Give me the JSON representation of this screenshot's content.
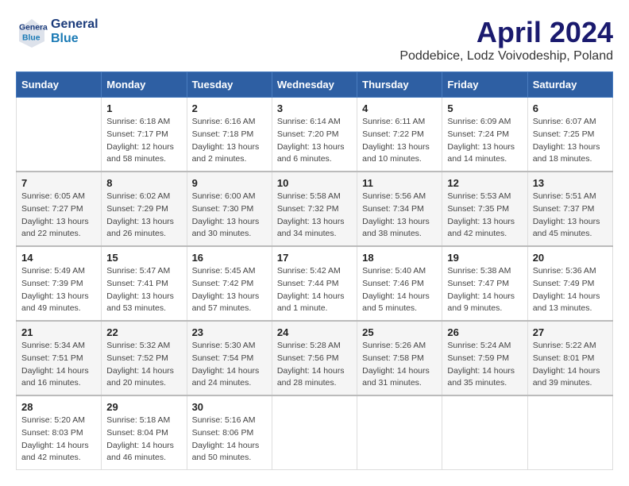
{
  "header": {
    "logo_line1": "General",
    "logo_line2": "Blue",
    "month": "April 2024",
    "location": "Poddebice, Lodz Voivodeship, Poland"
  },
  "weekdays": [
    "Sunday",
    "Monday",
    "Tuesday",
    "Wednesday",
    "Thursday",
    "Friday",
    "Saturday"
  ],
  "weeks": [
    [
      {
        "day": "",
        "info": ""
      },
      {
        "day": "1",
        "info": "Sunrise: 6:18 AM\nSunset: 7:17 PM\nDaylight: 12 hours\nand 58 minutes."
      },
      {
        "day": "2",
        "info": "Sunrise: 6:16 AM\nSunset: 7:18 PM\nDaylight: 13 hours\nand 2 minutes."
      },
      {
        "day": "3",
        "info": "Sunrise: 6:14 AM\nSunset: 7:20 PM\nDaylight: 13 hours\nand 6 minutes."
      },
      {
        "day": "4",
        "info": "Sunrise: 6:11 AM\nSunset: 7:22 PM\nDaylight: 13 hours\nand 10 minutes."
      },
      {
        "day": "5",
        "info": "Sunrise: 6:09 AM\nSunset: 7:24 PM\nDaylight: 13 hours\nand 14 minutes."
      },
      {
        "day": "6",
        "info": "Sunrise: 6:07 AM\nSunset: 7:25 PM\nDaylight: 13 hours\nand 18 minutes."
      }
    ],
    [
      {
        "day": "7",
        "info": "Sunrise: 6:05 AM\nSunset: 7:27 PM\nDaylight: 13 hours\nand 22 minutes."
      },
      {
        "day": "8",
        "info": "Sunrise: 6:02 AM\nSunset: 7:29 PM\nDaylight: 13 hours\nand 26 minutes."
      },
      {
        "day": "9",
        "info": "Sunrise: 6:00 AM\nSunset: 7:30 PM\nDaylight: 13 hours\nand 30 minutes."
      },
      {
        "day": "10",
        "info": "Sunrise: 5:58 AM\nSunset: 7:32 PM\nDaylight: 13 hours\nand 34 minutes."
      },
      {
        "day": "11",
        "info": "Sunrise: 5:56 AM\nSunset: 7:34 PM\nDaylight: 13 hours\nand 38 minutes."
      },
      {
        "day": "12",
        "info": "Sunrise: 5:53 AM\nSunset: 7:35 PM\nDaylight: 13 hours\nand 42 minutes."
      },
      {
        "day": "13",
        "info": "Sunrise: 5:51 AM\nSunset: 7:37 PM\nDaylight: 13 hours\nand 45 minutes."
      }
    ],
    [
      {
        "day": "14",
        "info": "Sunrise: 5:49 AM\nSunset: 7:39 PM\nDaylight: 13 hours\nand 49 minutes."
      },
      {
        "day": "15",
        "info": "Sunrise: 5:47 AM\nSunset: 7:41 PM\nDaylight: 13 hours\nand 53 minutes."
      },
      {
        "day": "16",
        "info": "Sunrise: 5:45 AM\nSunset: 7:42 PM\nDaylight: 13 hours\nand 57 minutes."
      },
      {
        "day": "17",
        "info": "Sunrise: 5:42 AM\nSunset: 7:44 PM\nDaylight: 14 hours\nand 1 minute."
      },
      {
        "day": "18",
        "info": "Sunrise: 5:40 AM\nSunset: 7:46 PM\nDaylight: 14 hours\nand 5 minutes."
      },
      {
        "day": "19",
        "info": "Sunrise: 5:38 AM\nSunset: 7:47 PM\nDaylight: 14 hours\nand 9 minutes."
      },
      {
        "day": "20",
        "info": "Sunrise: 5:36 AM\nSunset: 7:49 PM\nDaylight: 14 hours\nand 13 minutes."
      }
    ],
    [
      {
        "day": "21",
        "info": "Sunrise: 5:34 AM\nSunset: 7:51 PM\nDaylight: 14 hours\nand 16 minutes."
      },
      {
        "day": "22",
        "info": "Sunrise: 5:32 AM\nSunset: 7:52 PM\nDaylight: 14 hours\nand 20 minutes."
      },
      {
        "day": "23",
        "info": "Sunrise: 5:30 AM\nSunset: 7:54 PM\nDaylight: 14 hours\nand 24 minutes."
      },
      {
        "day": "24",
        "info": "Sunrise: 5:28 AM\nSunset: 7:56 PM\nDaylight: 14 hours\nand 28 minutes."
      },
      {
        "day": "25",
        "info": "Sunrise: 5:26 AM\nSunset: 7:58 PM\nDaylight: 14 hours\nand 31 minutes."
      },
      {
        "day": "26",
        "info": "Sunrise: 5:24 AM\nSunset: 7:59 PM\nDaylight: 14 hours\nand 35 minutes."
      },
      {
        "day": "27",
        "info": "Sunrise: 5:22 AM\nSunset: 8:01 PM\nDaylight: 14 hours\nand 39 minutes."
      }
    ],
    [
      {
        "day": "28",
        "info": "Sunrise: 5:20 AM\nSunset: 8:03 PM\nDaylight: 14 hours\nand 42 minutes."
      },
      {
        "day": "29",
        "info": "Sunrise: 5:18 AM\nSunset: 8:04 PM\nDaylight: 14 hours\nand 46 minutes."
      },
      {
        "day": "30",
        "info": "Sunrise: 5:16 AM\nSunset: 8:06 PM\nDaylight: 14 hours\nand 50 minutes."
      },
      {
        "day": "",
        "info": ""
      },
      {
        "day": "",
        "info": ""
      },
      {
        "day": "",
        "info": ""
      },
      {
        "day": "",
        "info": ""
      }
    ]
  ]
}
